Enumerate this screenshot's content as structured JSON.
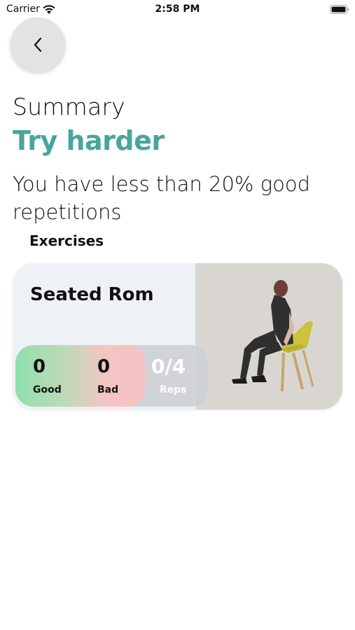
{
  "status_bar": {
    "carrier": "Carrier",
    "time": "2:58 PM"
  },
  "header": {
    "title": "Summary",
    "result": "Try harder",
    "message": "You have less than 20% good repetitions"
  },
  "exercises": {
    "label": "Exercises",
    "items": [
      {
        "name": "Seated Rom",
        "good": "0",
        "good_label": "Good",
        "bad": "0",
        "bad_label": "Bad",
        "reps": "0/4",
        "reps_label": "Reps"
      }
    ]
  },
  "colors": {
    "accent": "#47a69c",
    "good": "#8fe0ae",
    "bad": "#f6c0c2",
    "card_bg": "#eef1f6"
  }
}
